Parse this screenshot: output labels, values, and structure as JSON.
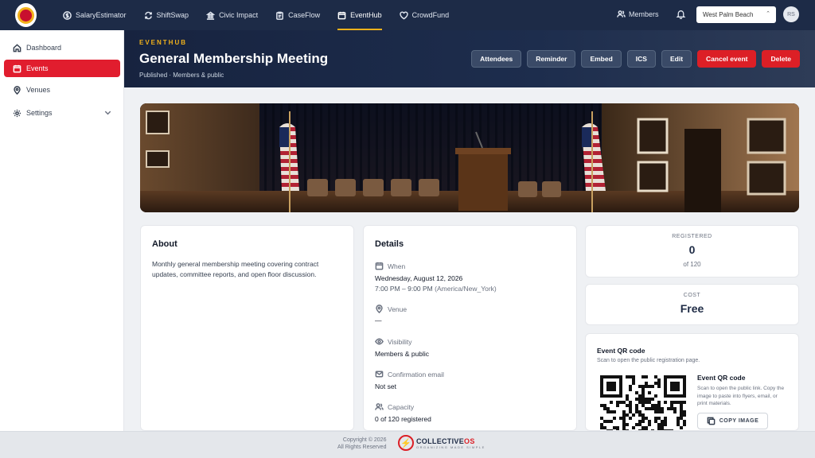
{
  "topnav": {
    "items": [
      {
        "label": "SalaryEstimator",
        "icon": "dollar-icon"
      },
      {
        "label": "ShiftSwap",
        "icon": "swap-icon"
      },
      {
        "label": "Civic Impact",
        "icon": "building-icon"
      },
      {
        "label": "CaseFlow",
        "icon": "clipboard-icon"
      },
      {
        "label": "EventHub",
        "icon": "calendar-icon"
      },
      {
        "label": "CrowdFund",
        "icon": "heart-icon"
      }
    ],
    "active_index": 4,
    "members_label": "Members",
    "city": "West Palm Beach",
    "avatar_initials": "RS"
  },
  "sidebar": {
    "items": [
      {
        "label": "Dashboard",
        "icon": "home-icon"
      },
      {
        "label": "Events",
        "icon": "calendar-icon"
      },
      {
        "label": "Venues",
        "icon": "map-pin-icon"
      },
      {
        "label": "Settings",
        "icon": "gear-icon"
      }
    ],
    "active_index": 1
  },
  "header": {
    "eyebrow": "EVENTHUB",
    "title": "General Membership Meeting",
    "subtitle": "Published · Members & public",
    "actions": [
      "Attendees",
      "Reminder",
      "Embed",
      "ICS",
      "Edit",
      "Cancel event",
      "Delete"
    ]
  },
  "about": {
    "heading": "About",
    "text": "Monthly general membership meeting covering contract updates, committee reports, and open floor discussion."
  },
  "details": {
    "heading": "Details",
    "when_label": "When",
    "when_date": "Wednesday, August 12, 2026",
    "when_time": "7:00 PM – 9:00 PM",
    "when_tz": "(America/New_York)",
    "venue_label": "Venue",
    "venue_value": "—",
    "visibility_label": "Visibility",
    "visibility_value": "Members & public",
    "confirmation_label": "Confirmation email",
    "confirmation_value": "Not set",
    "capacity_label": "Capacity",
    "capacity_value": "0 of 120 registered"
  },
  "stats": {
    "registered_label": "REGISTERED",
    "registered_value": "0",
    "registered_sub": "of 120",
    "cost_label": "COST",
    "cost_value": "Free"
  },
  "qr": {
    "heading": "Event QR code",
    "subheading": "Scan to open the public registration page.",
    "side_title": "Event QR code",
    "side_text": "Scan to open the public link. Copy the image to paste into flyers, email, or print materials.",
    "copy_label": "COPY IMAGE"
  },
  "footer": {
    "copyright": "Copyright © 2026",
    "rights": "All Rights Reserved",
    "brand_main": "COLLECTIVE",
    "brand_accent": "OS",
    "brand_tagline": "ORGANIZING MADE SIMPLE"
  },
  "colors": {
    "nav_bg": "#1d2b47",
    "accent_gold": "#f2b21b",
    "accent_red": "#dc1f26"
  }
}
